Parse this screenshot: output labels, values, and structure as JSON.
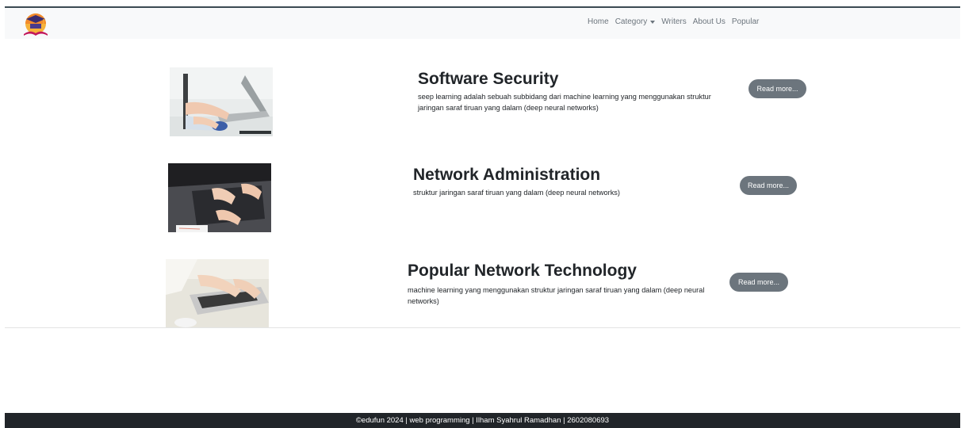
{
  "navbar": {
    "logo_icon": "graduation-cap-book-logo",
    "links": [
      "Home",
      "Category",
      "Writers",
      "About Us",
      "Popular"
    ]
  },
  "articles": [
    {
      "title": "Software Security",
      "description": "seep learning adalah sebuah subbidang dari machine learning yang menggunakan struktur jaringan saraf tiruan yang dalam (deep neural networks)",
      "button": "Read more..."
    },
    {
      "title": "Network Administration",
      "description": "struktur jaringan saraf tiruan yang dalam (deep neural networks)",
      "button": "Read more..."
    },
    {
      "title": "Popular Network Technology",
      "description": "machine learning yang menggunakan struktur jaringan saraf tiruan yang dalam (deep neural networks)",
      "button": "Read more..."
    }
  ],
  "footer": {
    "text": "©edufun 2024 | web programming | Ilham Syahrul Ramadhan | 2602080693"
  },
  "colors": {
    "navbar_bg": "#f8f9fa",
    "button_bg": "#6c757d",
    "footer_bg": "#212529"
  }
}
